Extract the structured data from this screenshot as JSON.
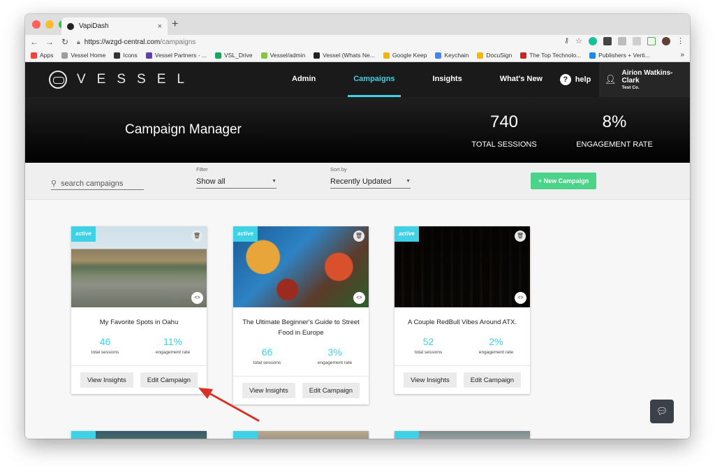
{
  "browser": {
    "tab_title": "VapiDash",
    "tab_close": "×",
    "new_tab": "+",
    "url_host": "https://wzgd-central.com",
    "url_path": "/campaigns",
    "bookmarks": [
      {
        "label": "Apps",
        "color": "#e8453c"
      },
      {
        "label": "Vessel Home",
        "color": "#9e9e9e"
      },
      {
        "label": "Icons",
        "color": "#333333"
      },
      {
        "label": "Vessel Partners - ...",
        "color": "#5c3fb3"
      },
      {
        "label": "VSL_Drive",
        "color": "#1ea362"
      },
      {
        "label": "Vessel/admin",
        "color": "#8bc34a"
      },
      {
        "label": "Vessel (Whats Ne...",
        "color": "#222222"
      },
      {
        "label": "Google Keep",
        "color": "#f4b400"
      },
      {
        "label": "Keychain",
        "color": "#4285f4"
      },
      {
        "label": "DocuSign",
        "color": "#f6b900"
      },
      {
        "label": "The Top Technolo...",
        "color": "#c62828"
      },
      {
        "label": "Publishers + Verti...",
        "color": "#1e88e5"
      }
    ],
    "bookmarks_more": "»"
  },
  "header": {
    "logo_text": "VESSEL",
    "menu": [
      "Admin",
      "Campaigns",
      "Insights",
      "What's New"
    ],
    "active_menu": "Campaigns",
    "help": "help",
    "user_name": "Airion Watkins-Clark",
    "user_company": "Test Co."
  },
  "banner": {
    "title": "Campaign Manager",
    "sessions_value": "740",
    "sessions_label": "TOTAL SESSIONS",
    "engagement_value": "8%",
    "engagement_label": "ENGAGEMENT RATE"
  },
  "toolbar": {
    "search_placeholder": "search campaigns",
    "filter_label": "Filter",
    "filter_value": "Show all",
    "sort_label": "Sort by",
    "sort_value": "Recently Updated",
    "new_campaign": "+ New Campaign"
  },
  "campaigns": [
    {
      "status": "active",
      "title": "My Favorite Spots in Oahu",
      "sessions": "46",
      "sessions_label": "total sessions",
      "engagement": "11%",
      "engagement_label": "engagement rate",
      "view": "View Insights",
      "edit": "Edit Campaign"
    },
    {
      "status": "active",
      "title": "The Ultimate Beginner's Guide to Street Food in Europe",
      "sessions": "66",
      "sessions_label": "total sessions",
      "engagement": "3%",
      "engagement_label": "engagement rate",
      "view": "View Insights",
      "edit": "Edit Campaign"
    },
    {
      "status": "active",
      "title": "A Couple RedBull Vibes Around ATX.",
      "sessions": "52",
      "sessions_label": "total sessions",
      "engagement": "2%",
      "engagement_label": "engagement rate",
      "view": "View Insights",
      "edit": "Edit Campaign"
    }
  ],
  "colors": {
    "accent": "#3fd1e6",
    "new_button": "#4cd38a",
    "annotation_arrow": "#d93025"
  }
}
